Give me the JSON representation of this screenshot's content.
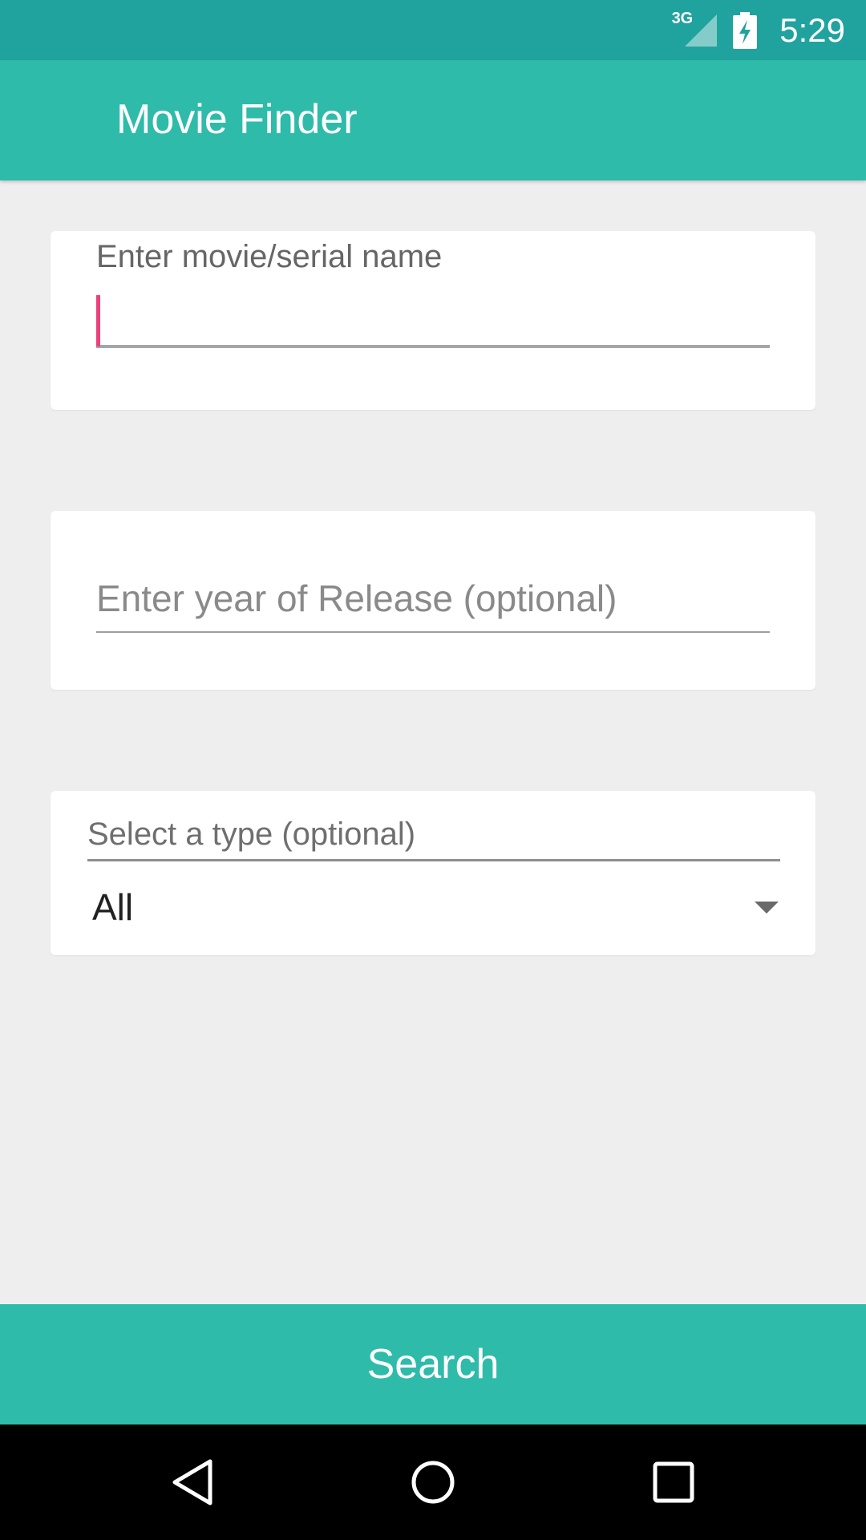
{
  "status_bar": {
    "network": "3G",
    "time": "5:29"
  },
  "app_bar": {
    "title": "Movie Finder"
  },
  "form": {
    "name_field": {
      "label": "Enter movie/serial name",
      "value": ""
    },
    "year_field": {
      "placeholder": "Enter year of Release (optional)",
      "value": ""
    },
    "type_field": {
      "label": "Select a type (optional)",
      "selected": "All"
    }
  },
  "search_button": {
    "label": "Search"
  },
  "nav_bar": {
    "icons": [
      "back-icon",
      "home-icon",
      "recents-icon"
    ]
  },
  "colors": {
    "status_bar": "#20a39e",
    "primary": "#2ebbaa",
    "accent_cursor": "#ec407a",
    "background": "#eeeeee"
  }
}
